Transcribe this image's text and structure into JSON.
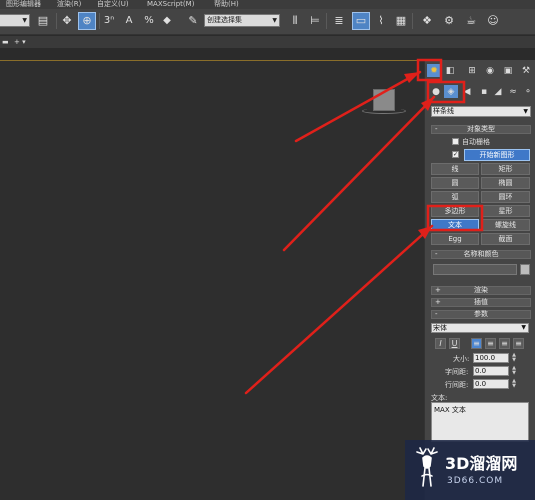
{
  "menu": {
    "items": [
      "图形编辑器",
      "渲染(R)",
      "自定义(U)",
      "MAXScript(M)",
      "帮助(H)"
    ]
  },
  "toolbar": {
    "selection_set_placeholder": "创建选择集",
    "snap_3_label": "3",
    "snap_angle_label": "A",
    "snap_percent_label": "%",
    "snap_spinner_label": "n"
  },
  "viewport": {
    "label": "+ ▾"
  },
  "command_panel": {
    "top_tabs": [
      "create-icon",
      "modify-icon",
      "hierarchy-icon",
      "motion-icon",
      "display-icon",
      "utilities-icon"
    ],
    "sub_tabs": [
      "geometry-icon",
      "shapes-icon",
      "lights-icon",
      "cameras-icon",
      "helpers-icon",
      "spacewarps-icon",
      "systems-icon"
    ],
    "category_dropdown": "样条线",
    "object_type_title": "对象类型",
    "autogrid_label": "自动栅格",
    "start_new_shape_label": "开始新图形",
    "object_buttons": [
      "线",
      "矩形",
      "圆",
      "椭圆",
      "弧",
      "圆环",
      "多边形",
      "星形",
      "文本",
      "螺旋线",
      "Egg",
      "截面"
    ],
    "selected_object": "文本",
    "name_color_title": "名称和颜色",
    "rendering_title": "渲染",
    "interpolation_title": "插值",
    "parameters_title": "参数",
    "font_value": "宋体",
    "size_label": "大小:",
    "size_value": "100.0",
    "kerning_label": "字间距:",
    "kerning_value": "0.0",
    "leading_label": "行间距:",
    "leading_value": "0.0",
    "text_label": "文本:",
    "text_value": "MAX 文本"
  },
  "colors": {
    "accent": "#3f78c8",
    "annotation": "#e0201a"
  },
  "watermark": {
    "brand": "3D溜溜网",
    "url": "3D66.COM"
  }
}
